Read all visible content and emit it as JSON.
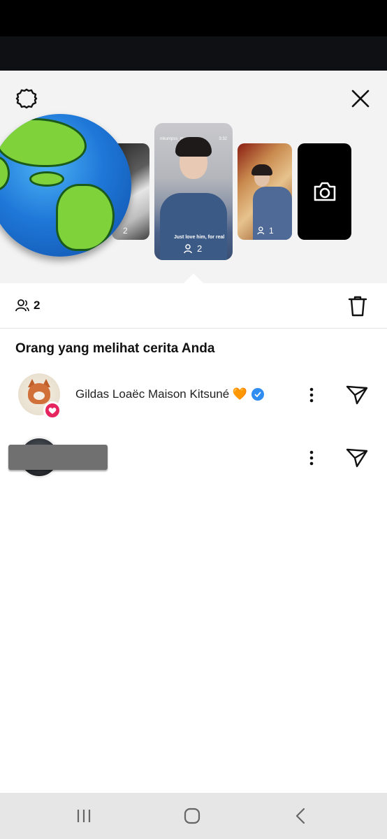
{
  "header": {
    "settings_icon": "settings-gear-icon",
    "close_icon": "close-x-icon"
  },
  "stories": {
    "previous": {
      "view_count": "2"
    },
    "current": {
      "username": "nikumpss_mua",
      "time": "3:32",
      "caption": "Just love him, for real",
      "view_count": "2"
    },
    "next": {
      "view_count": "1"
    },
    "camera_icon": "camera-icon"
  },
  "summary": {
    "viewer_count": "2",
    "delete_icon": "trash-icon"
  },
  "section": {
    "title": "Orang yang melihat cerita Anda"
  },
  "viewers": [
    {
      "name": "Gildas Loaëc Maison Kitsuné 🧡",
      "verified": true,
      "liked": true
    },
    {
      "name": "",
      "verified": false,
      "liked": false
    }
  ],
  "colors": {
    "like_badge": "#e6245e",
    "verified_badge": "#2f8cf0",
    "nav_bar": "#e6e6e6"
  },
  "nav": {
    "recent_icon": "recent-apps-icon",
    "home_icon": "home-icon",
    "back_icon": "back-icon"
  }
}
